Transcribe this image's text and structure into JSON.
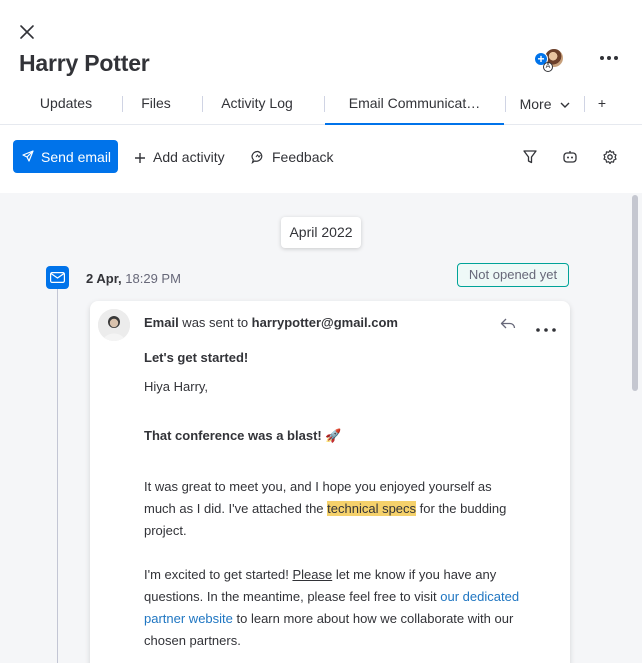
{
  "header": {
    "title": "Harry Potter",
    "avatar_plus": "+",
    "avatar_badge": "A"
  },
  "tabs": [
    {
      "label": "Updates",
      "active": false
    },
    {
      "label": "Files",
      "active": false
    },
    {
      "label": "Activity Log",
      "active": false
    },
    {
      "label": "Email Communicat…",
      "active": true
    },
    {
      "label": "More",
      "active": false
    },
    {
      "label": "+",
      "active": false
    }
  ],
  "toolbar": {
    "send_email": "Send email",
    "add_activity": "Add activity",
    "feedback": "Feedback",
    "icons": [
      "filter-icon",
      "robot-icon",
      "settings-icon"
    ]
  },
  "feed": {
    "month": "April 2022",
    "entry": {
      "date": "2 Apr,",
      "time": "18:29 PM",
      "status": "Not opened yet",
      "head_label": "Email",
      "head_mid": " was sent to ",
      "recipient": "harrypotter@gmail.com",
      "subject": "Let's get started!",
      "greeting": "Hiya Harry,",
      "heading": "That conference was a blast! 🚀",
      "para1_a": "It was great to meet you, and I hope you enjoyed yourself as much as I did. I've attached the ",
      "para1_highlight": "technical specs",
      "para1_b": " for the budding project.",
      "para2_a": "I'm excited to get started! ",
      "para2_underline": "Please",
      "para2_b": " let me know if you have any questions. In the meantime, please feel free to visit ",
      "para2_link": "our dedicated partner website",
      "para2_c": " to learn more about how we collaborate with our chosen partners."
    }
  },
  "colors": {
    "primary": "#0073ea",
    "status_border": "#00a398",
    "highlight": "#f5d16b",
    "link": "#1f76c2"
  }
}
